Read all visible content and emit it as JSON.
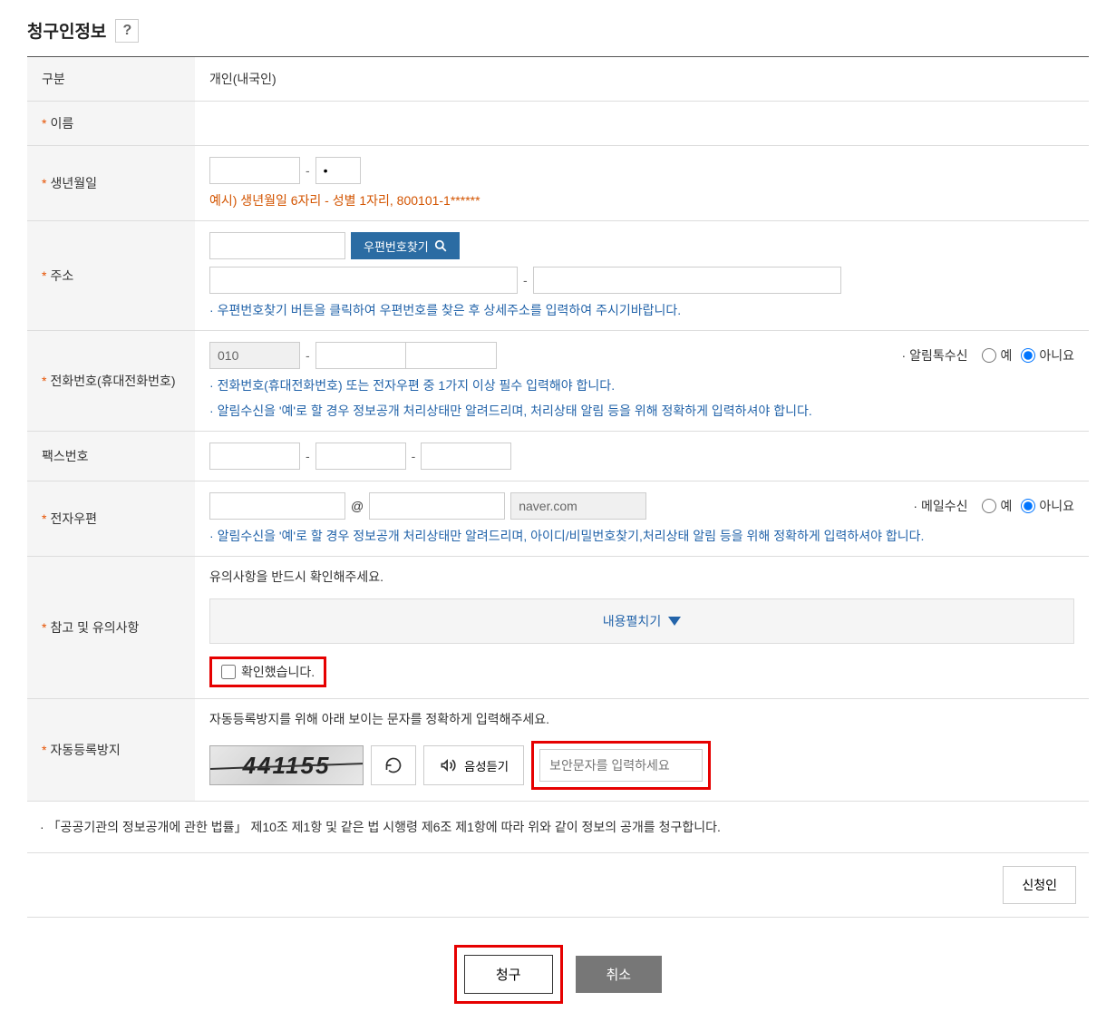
{
  "title": "청구인정보",
  "rows": {
    "category": {
      "label": "구분",
      "value": "개인(내국인)"
    },
    "name": {
      "label": "이름"
    },
    "birthdate": {
      "label": "생년월일",
      "hint": "예시) 생년월일 6자리 - 성별 1자리, 800101-1******"
    },
    "address": {
      "label": "주소",
      "zip_search": "우편번호찾기",
      "hint": "우편번호찾기 버튼을 클릭하여 우편번호를 찾은 후 상세주소를 입력하여 주시기바랍니다."
    },
    "phone": {
      "label": "전화번호(휴대전화번호)",
      "prefix": "010",
      "sms_label": "알림톡수신",
      "yes": "예",
      "no": "아니요",
      "hint1": "전화번호(휴대전화번호) 또는 전자우편 중 1가지 이상 필수 입력해야 합니다.",
      "hint2": "알림수신을 '예'로 할 경우 정보공개 처리상태만 알려드리며, 처리상태 알림 등을 위해 정확하게 입력하셔야 합니다."
    },
    "fax": {
      "label": "팩스번호"
    },
    "email": {
      "label": "전자우편",
      "at": "@",
      "domain_placeholder": "naver.com",
      "mail_label": "메일수신",
      "yes": "예",
      "no": "아니요",
      "hint": "알림수신을 '예'로 할 경우 정보공개 처리상태만 알려드리며, 아이디/비밀번호찾기,처리상태 알림 등을 위해 정확하게 입력하셔야 합니다."
    },
    "notice": {
      "label": "참고 및 유의사항",
      "text": "유의사항을 반드시 확인해주세요.",
      "expand": "내용펼치기",
      "confirm": "확인했습니다."
    },
    "captcha": {
      "label": "자동등록방지",
      "text": "자동등록방지를 위해 아래 보이는 문자를 정확하게 입력해주세요.",
      "value": "441155",
      "audio_label": "음성듣기",
      "placeholder": "보안문자를 입력하세요"
    }
  },
  "footer_note": "「공공기관의 정보공개에 관한 법률」 제10조 제1항 및 같은 법 시행령 제6조 제1항에 따라 위와 같이 정보의 공개를 청구합니다.",
  "applicant_label": "신청인",
  "submit_label": "청구",
  "cancel_label": "취소"
}
